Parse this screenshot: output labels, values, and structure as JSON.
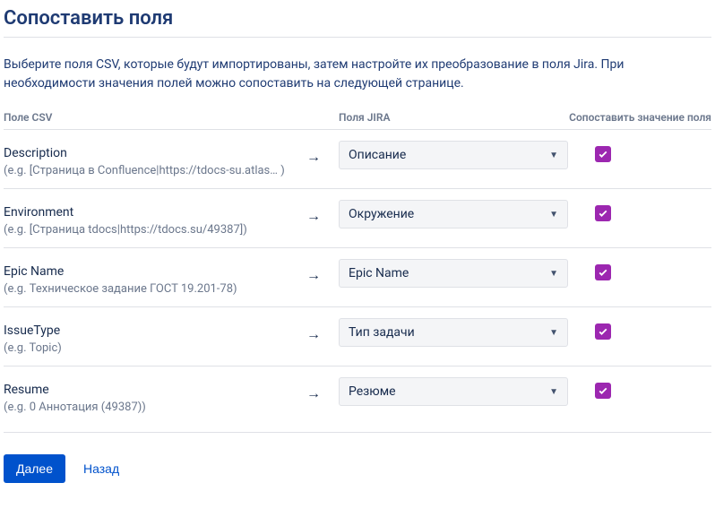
{
  "page": {
    "title": "Сопоставить поля",
    "description": "Выберите поля CSV, которые будут импортированы, затем настройте их преобразование в поля Jira. При необходимости значения полей можно сопоставить на следующей странице."
  },
  "table": {
    "header_csv": "Поле CSV",
    "header_jira": "Поля JIRA",
    "header_check": "Сопоставить значение поля"
  },
  "rows": [
    {
      "csv_name": "Description",
      "csv_hint": "(e.g.  [Страница в Confluence|https://tdocs-su.atlas… )",
      "jira_field": "Описание",
      "checked": true
    },
    {
      "csv_name": "Environment",
      "csv_hint": "(e.g.  [Страница tdocs|https://tdocs.su/49387])",
      "jira_field": "Окружение",
      "checked": true
    },
    {
      "csv_name": "Epic Name",
      "csv_hint": "(e.g.  Техническое задание ГОСТ 19.201-78)",
      "jira_field": "Epic Name",
      "checked": true
    },
    {
      "csv_name": "IssueType",
      "csv_hint": "(e.g.  Topic)",
      "jira_field": "Тип задачи",
      "checked": true
    },
    {
      "csv_name": "Resume",
      "csv_hint": "(e.g.  0 Аннотация (49387))",
      "jira_field": "Резюме",
      "checked": true
    }
  ],
  "buttons": {
    "next": "Далее",
    "back": "Назад"
  }
}
